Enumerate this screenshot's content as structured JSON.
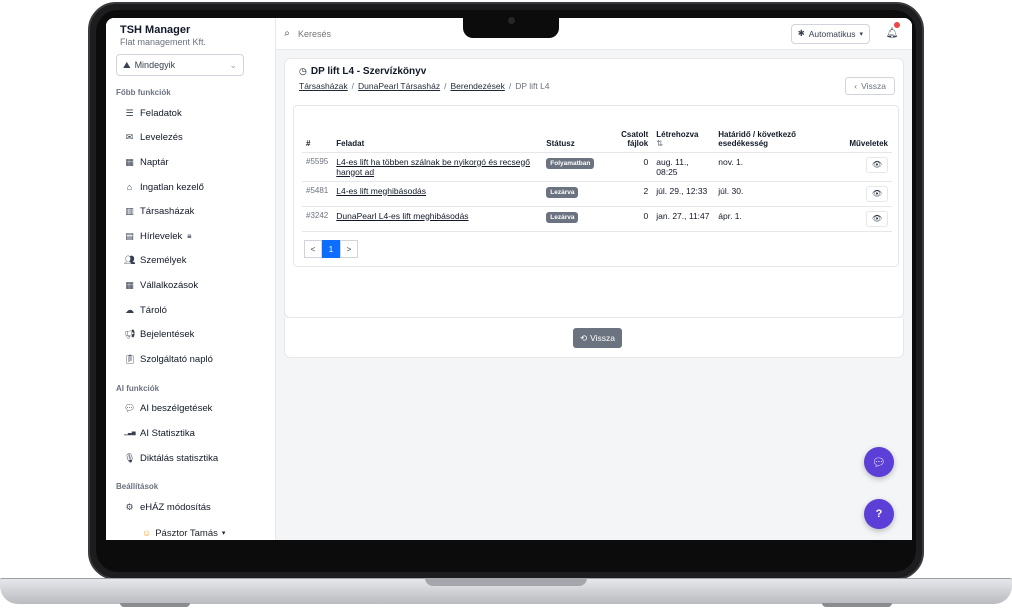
{
  "app": {
    "title": "TSH Manager",
    "subtitle": "Flat management Kft."
  },
  "sidebar": {
    "filter_value": "Mindegyik",
    "sections": [
      {
        "label": "Főbb funkciók",
        "items": [
          {
            "label": "Feladatok",
            "icon": "list-icon"
          },
          {
            "label": "Levelezés",
            "icon": "mail-icon"
          },
          {
            "label": "Naptár",
            "icon": "calendar-icon"
          },
          {
            "label": "Ingatlan kezelő",
            "icon": "house-icon"
          },
          {
            "label": "Társasházak",
            "icon": "building-icon"
          },
          {
            "label": "Hírlevelek",
            "icon": "newsletter-icon",
            "locked": true
          },
          {
            "label": "Személyek",
            "icon": "people-icon"
          },
          {
            "label": "Vállalkozások",
            "icon": "company-icon"
          },
          {
            "label": "Tároló",
            "icon": "cloud-icon"
          },
          {
            "label": "Bejelentések",
            "icon": "megaphone-icon"
          },
          {
            "label": "Szolgáltató napló",
            "icon": "clipboard-icon"
          }
        ]
      },
      {
        "label": "AI funkciók",
        "items": [
          {
            "label": "AI beszélgetések",
            "icon": "chat-icon"
          },
          {
            "label": "AI Statisztika",
            "icon": "bar-chart-icon"
          },
          {
            "label": "Diktálás statisztika",
            "icon": "microphone-icon"
          }
        ]
      },
      {
        "label": "Beállítások",
        "items": [
          {
            "label": "eHÁZ módosítás",
            "icon": "gear-icon"
          }
        ]
      }
    ],
    "user_name": "Pásztor Tamás"
  },
  "topbar": {
    "search_placeholder": "Keresés",
    "mode_label": "Automatikus"
  },
  "page": {
    "title": "DP lift L4 - Szervízkönyv",
    "breadcrumb": [
      "Társasházak",
      "DunaPearl Társasház",
      "Berendezések",
      "DP lift L4"
    ],
    "back_label": "Vissza"
  },
  "table": {
    "headers": [
      "#",
      "Feladat",
      "Státusz",
      "Csatolt fájlok",
      "Létrehozva",
      "Határidő / következő esedékesség",
      "Műveletek"
    ],
    "rows": [
      {
        "id": "#5595",
        "task": "L4-es lift ha többen szálnak be nyikorgó és recsegő hangot ad",
        "status": "Folyamatban",
        "files": "0",
        "created": "aug. 11., 08:25",
        "deadline": "nov. 1."
      },
      {
        "id": "#5481",
        "task": "L4-es lift meghibásodás",
        "status": "Lezárva",
        "files": "2",
        "created": "júl. 29., 12:33",
        "deadline": "júl. 30."
      },
      {
        "id": "#3242",
        "task": "DunaPearl L4-es lift meghibásodás",
        "status": "Lezárva",
        "files": "0",
        "created": "jan. 27., 11:47",
        "deadline": "ápr. 1."
      }
    ],
    "pagination": {
      "prev": "<",
      "current": "1",
      "next": ">"
    }
  },
  "footer": {
    "back_label": "Vissza"
  },
  "colors": {
    "accent": "#0d6efd",
    "fab": "#5b3fd6",
    "badge": "#6b7280"
  }
}
